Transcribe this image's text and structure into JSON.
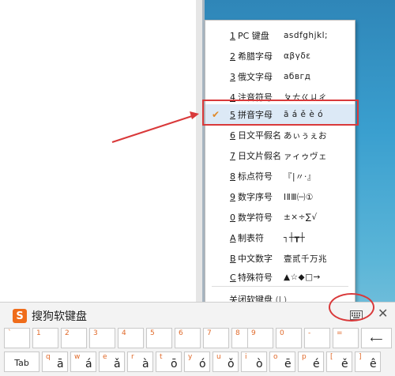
{
  "menu": {
    "items": [
      {
        "num": "1",
        "label": "PC 键盘",
        "sample": "asdfghjkl;"
      },
      {
        "num": "2",
        "label": "希腊字母",
        "sample": "αβγδε"
      },
      {
        "num": "3",
        "label": "俄文字母",
        "sample": "абвгд"
      },
      {
        "num": "4",
        "label": "注音符号",
        "sample": "ㄆㄊㄍㄐㄔ"
      },
      {
        "num": "5",
        "label": "拼音字母",
        "sample": "ā á ě è ó",
        "checked": true
      },
      {
        "num": "6",
        "label": "日文平假名",
        "sample": "あぃぅぇお"
      },
      {
        "num": "7",
        "label": "日文片假名",
        "sample": "ァィゥヴェ"
      },
      {
        "num": "8",
        "label": "标点符号",
        "sample": "『|〃·』"
      },
      {
        "num": "9",
        "label": "数字序号",
        "sample": "ⅠⅡⅢ㈠①"
      },
      {
        "num": "0",
        "label": "数学符号",
        "sample": "±×÷∑√"
      },
      {
        "num": "A",
        "label": "制表符",
        "sample": "┐┼┳┼"
      },
      {
        "num": "B",
        "label": "中文数字",
        "sample": "壹贰千万兆"
      },
      {
        "num": "C",
        "label": "特殊符号",
        "sample": "▲☆◆□→"
      }
    ],
    "close_label": "关闭软键盘",
    "close_shortcut": "(L)",
    "check_mark": "✔"
  },
  "keyboard": {
    "title": "搜狗软键盘",
    "logo_letter": "S",
    "close_symbol": "✕",
    "row1": [
      {
        "top": "`",
        "main": ""
      },
      {
        "top": "1",
        "main": ""
      },
      {
        "top": "2",
        "main": ""
      },
      {
        "top": "3",
        "main": ""
      },
      {
        "top": "4",
        "main": ""
      },
      {
        "top": "5",
        "main": ""
      },
      {
        "top": "6",
        "main": ""
      },
      {
        "top": "7",
        "main": ""
      },
      {
        "top": "8",
        "main": ""
      },
      {
        "top": "9",
        "main": ""
      },
      {
        "top": "0",
        "main": ""
      },
      {
        "top": "-",
        "main": ""
      },
      {
        "top": "=",
        "main": ""
      }
    ],
    "backspace_symbol": "⟵",
    "tab_label": "Tab",
    "row2": [
      {
        "top": "q",
        "main": "ā"
      },
      {
        "top": "w",
        "main": "á"
      },
      {
        "top": "e",
        "main": "ǎ"
      },
      {
        "top": "r",
        "main": "à"
      },
      {
        "top": "t",
        "main": "ō"
      },
      {
        "top": "y",
        "main": "ó"
      },
      {
        "top": "u",
        "main": "ǒ"
      },
      {
        "top": "i",
        "main": "ò"
      },
      {
        "top": "o",
        "main": "ē"
      },
      {
        "top": "p",
        "main": "é"
      },
      {
        "top": "[",
        "main": "ě"
      },
      {
        "top": "]",
        "main": "ê"
      }
    ],
    "accent_color": "#ef6c1a"
  },
  "annotation_color": "#d9393a"
}
